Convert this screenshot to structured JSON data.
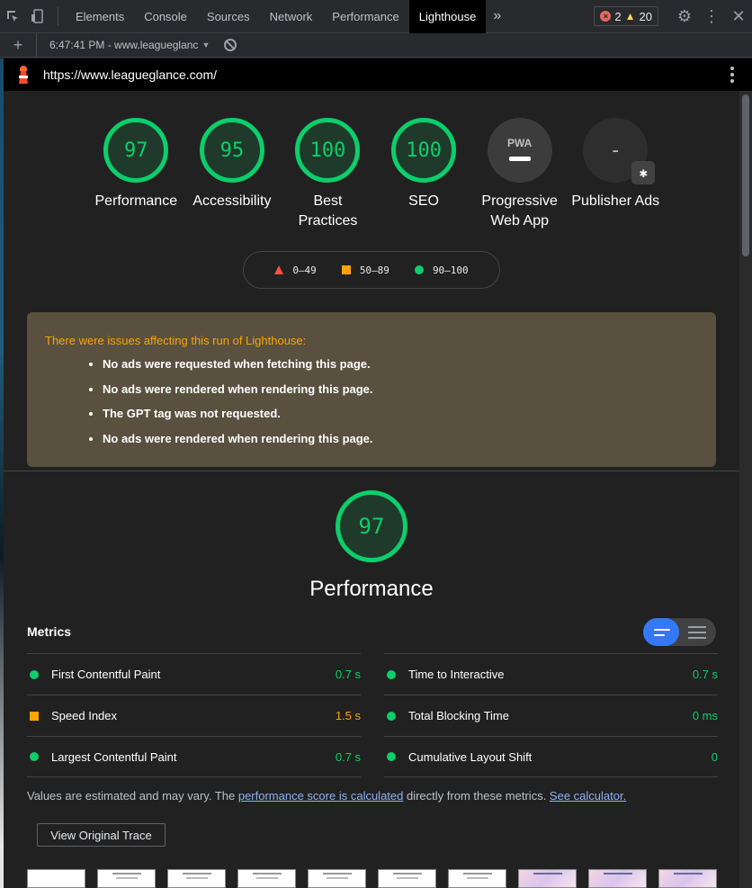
{
  "devtools": {
    "tabs": [
      "Elements",
      "Console",
      "Sources",
      "Network",
      "Performance",
      "Lighthouse"
    ],
    "active_tab": "Lighthouse",
    "error_count": "2",
    "warning_count": "20"
  },
  "toolbar": {
    "run_label": "6:47:41 PM - www.leagueglanc"
  },
  "url": "https://www.leagueglance.com/",
  "categories": [
    {
      "score": "97",
      "label": "Performance"
    },
    {
      "score": "95",
      "label": "Accessibility"
    },
    {
      "score": "100",
      "label": "Best Practices"
    },
    {
      "score": "100",
      "label": "SEO"
    },
    {
      "score": "PWA",
      "label": "Progressive Web App"
    },
    {
      "score": "-",
      "label": "Publisher Ads"
    }
  ],
  "legend": {
    "fail": "0–49",
    "average": "50–89",
    "pass": "90–100"
  },
  "warnings": {
    "title": "There were issues affecting this run of Lighthouse:",
    "items": [
      "No ads were requested when fetching this page.",
      "No ads were rendered when rendering this page.",
      "The GPT tag was not requested.",
      "No ads were rendered when rendering this page."
    ]
  },
  "performance": {
    "score": "97",
    "title": "Performance",
    "metrics_heading": "Metrics",
    "metrics_left": [
      {
        "name": "First Contentful Paint",
        "value": "0.7 s",
        "rating": "good"
      },
      {
        "name": "Speed Index",
        "value": "1.5 s",
        "rating": "average"
      },
      {
        "name": "Largest Contentful Paint",
        "value": "0.7 s",
        "rating": "good"
      }
    ],
    "metrics_right": [
      {
        "name": "Time to Interactive",
        "value": "0.7 s",
        "rating": "good"
      },
      {
        "name": "Total Blocking Time",
        "value": "0 ms",
        "rating": "good"
      },
      {
        "name": "Cumulative Layout Shift",
        "value": "0",
        "rating": "good"
      }
    ],
    "note_prefix": "Values are estimated and may vary. The ",
    "note_link": "performance score is calculated",
    "note_mid": " directly from these metrics. ",
    "note_link2": "See calculator.",
    "trace_button": "View Original Trace"
  },
  "colors": {
    "pass": "#0cce6b",
    "average": "#ffa400",
    "fail": "#ff4e42",
    "accent": "#3478f6"
  }
}
